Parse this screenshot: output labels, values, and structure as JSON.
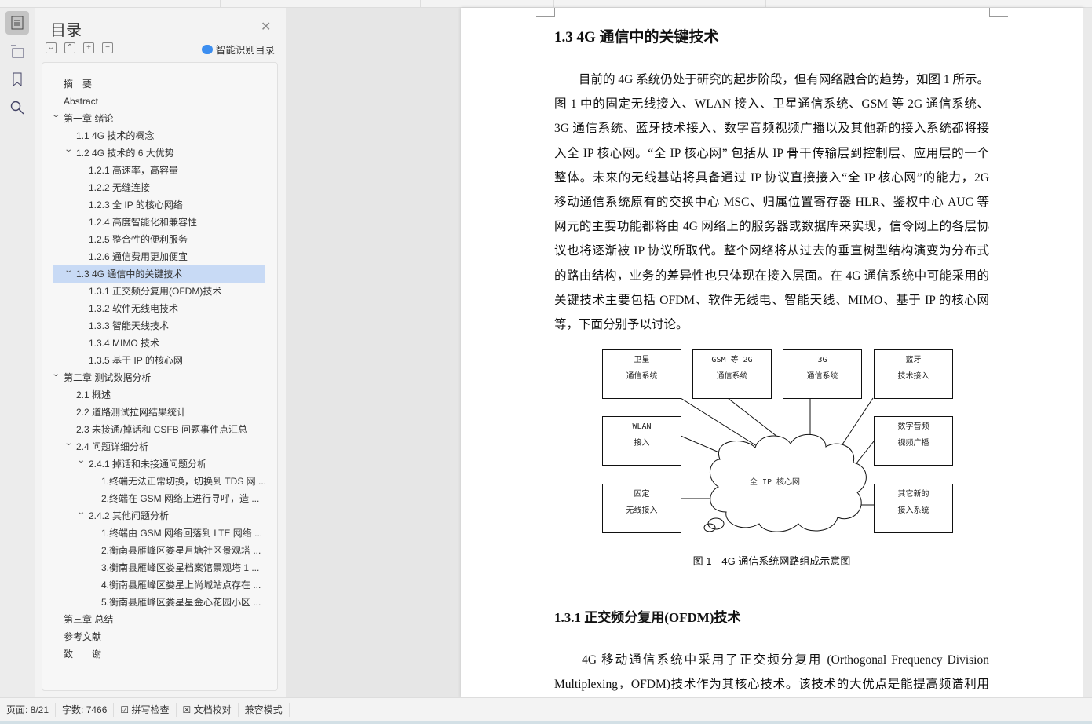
{
  "toc": {
    "title": "目录",
    "smart_label": "智能识别目录",
    "tools": [
      "expand-down",
      "collapse-up",
      "expand-all",
      "collapse-all"
    ],
    "items": [
      {
        "label": "摘　要",
        "level": 0
      },
      {
        "label": "Abstract",
        "level": 0
      },
      {
        "label": "第一章  绪论",
        "level": 0,
        "expanded": true
      },
      {
        "label": "1.1 4G 技术的概念",
        "level": 1
      },
      {
        "label": "1.2 4G 技术的 6 大优势",
        "level": 1,
        "expanded": true
      },
      {
        "label": "1.2.1 高速率，高容量",
        "level": 2
      },
      {
        "label": "1.2.2 无缝连接",
        "level": 2
      },
      {
        "label": "1.2.3 全 IP 的核心网络",
        "level": 2
      },
      {
        "label": "1.2.4 高度智能化和兼容性",
        "level": 2
      },
      {
        "label": "1.2.5 整合性的便利服务",
        "level": 2
      },
      {
        "label": "1.2.6 通信费用更加便宜",
        "level": 2
      },
      {
        "label": "1.3 4G 通信中的关键技术",
        "level": 1,
        "expanded": true,
        "selected": true
      },
      {
        "label": "1.3.1  正交频分复用(OFDM)技术",
        "level": 2
      },
      {
        "label": "1.3.2  软件无线电技术",
        "level": 2
      },
      {
        "label": "1.3.3  智能天线技术",
        "level": 2
      },
      {
        "label": "1.3.4 MIMO 技术",
        "level": 2
      },
      {
        "label": "1.3.5  基于 IP 的核心网",
        "level": 2
      },
      {
        "label": "第二章  测试数据分析",
        "level": 0,
        "expanded": true
      },
      {
        "label": "2.1 概述",
        "level": 1
      },
      {
        "label": "2.2 道路测试拉网结果统计",
        "level": 1
      },
      {
        "label": "2.3 未接通/掉话和 CSFB 问题事件点汇总",
        "level": 1
      },
      {
        "label": "2.4 问题详细分析",
        "level": 1,
        "expanded": true
      },
      {
        "label": "2.4.1 掉话和未接通问题分析",
        "level": 2,
        "expanded": true
      },
      {
        "label": "1.终端无法正常切换，切换到 TDS 网 ...",
        "level": 3
      },
      {
        "label": "2.终端在 GSM 网络上进行寻呼，造 ...",
        "level": 3
      },
      {
        "label": "2.4.2 其他问题分析",
        "level": 2,
        "expanded": true
      },
      {
        "label": "1.终端由 GSM 网络回落到 LTE 网络 ...",
        "level": 3
      },
      {
        "label": "2.衡南县雁峰区娄星月塘社区景观塔 ...",
        "level": 3
      },
      {
        "label": "3.衡南县雁峰区娄星档案馆景观塔 1  ...",
        "level": 3
      },
      {
        "label": "4.衡南县雁峰区娄星上尚城站点存在  ...",
        "level": 3
      },
      {
        "label": "5.衡南县雁峰区娄星星金心花园小区 ...",
        "level": 3
      },
      {
        "label": "第三章  总结",
        "level": 0
      },
      {
        "label": "参考文献",
        "level": 0
      },
      {
        "label": "致　　谢",
        "level": 0
      }
    ]
  },
  "doc": {
    "heading": "1.3 4G 通信中的关键技术",
    "para1": [
      "　　目前的 4G 系统仍处于研究的起步阶段，但有网络融合的趋势，如图 1 所示。",
      "图 1 中的固定无线接入、WLAN 接入、卫星通信系统、GSM 等 2G 通信系统、",
      "3G 通信系统、蓝牙技术接入、数字音频视频广播以及其他新的接入系统都将接",
      "入全 IP 核心网。“全 IP 核心网” 包括从 IP 骨干传输层到控制层、应用层的一个",
      "整体。未来的无线基站将具备通过 IP 协议直接接入“全 IP 核心网”的能力，2G",
      "移动通信系统原有的交换中心 MSC、归属位置寄存器 HLR、鉴权中心 AUC 等",
      "网元的主要功能都将由 4G 网络上的服务器或数据库来实现，信令网上的各层协",
      "议也将逐渐被 IP 协议所取代。整个网络将从过去的垂直树型结构演变为分布式",
      "的路由结构，业务的差异性也只体现在接入层面。在 4G 通信系统中可能采用的",
      "关键技术主要包括 OFDM、软件无线电、智能天线、MIMO、基于 IP 的核心网",
      "等，下面分别予以讨论。"
    ],
    "figure": {
      "center": "全 IP 核心网",
      "boxes": [
        [
          "卫星",
          "通信系统"
        ],
        [
          "GSM 等 2G",
          "通信系统"
        ],
        [
          "3G",
          "通信系统"
        ],
        [
          "蓝牙",
          "技术接入"
        ],
        [
          "WLAN",
          "接入"
        ],
        [
          "数字音频",
          "视频广播"
        ],
        [
          "固定",
          "无线接入"
        ],
        [
          "其它新的",
          "接入系统"
        ]
      ],
      "caption": "图 1　4G 通信系统网路组成示意图"
    },
    "subheading": "1.3.1  正交频分复用(OFDM)技术",
    "para2": [
      "　　4G 移动通信系统中采用了正交频分复用 (Orthogonal Frequency Division",
      "Multiplexing，OFDM)技术作为其核心技术。该技术的大优点是能提高频谱利用"
    ]
  },
  "status": {
    "page": "页面: 8/21",
    "words": "字数: 7466",
    "spell": "拼写检查",
    "proof": "文档校对",
    "compat": "兼容模式"
  }
}
